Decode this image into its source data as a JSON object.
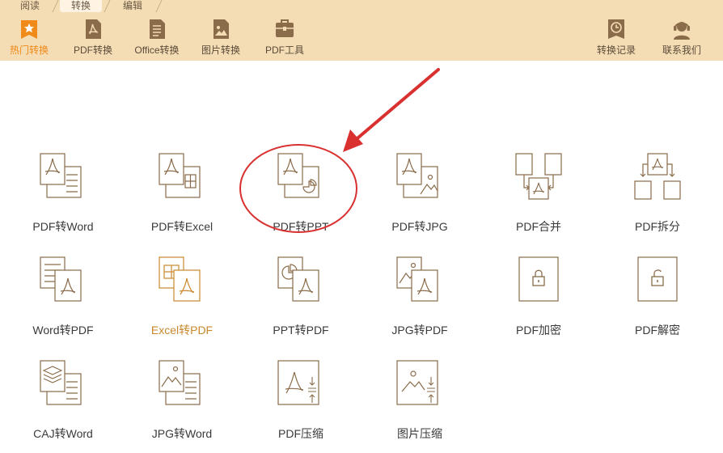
{
  "tabs": [
    {
      "label": "阅读"
    },
    {
      "label": "转换"
    },
    {
      "label": "编辑"
    }
  ],
  "toolbar": {
    "left": [
      {
        "label": "热门转换",
        "icon": "star-icon"
      },
      {
        "label": "PDF转换",
        "icon": "pdf-file-icon"
      },
      {
        "label": "Office转换",
        "icon": "document-icon"
      },
      {
        "label": "图片转换",
        "icon": "image-file-icon"
      },
      {
        "label": "PDF工具",
        "icon": "briefcase-icon"
      }
    ],
    "right": [
      {
        "label": "转换记录",
        "icon": "clock-icon"
      },
      {
        "label": "联系我们",
        "icon": "headset-icon"
      }
    ]
  },
  "grid": [
    {
      "label": "PDF转Word"
    },
    {
      "label": "PDF转Excel"
    },
    {
      "label": "PDF转PPT"
    },
    {
      "label": "PDF转JPG"
    },
    {
      "label": "PDF合并"
    },
    {
      "label": "PDF拆分"
    },
    {
      "label": "Word转PDF"
    },
    {
      "label": "Excel转PDF"
    },
    {
      "label": "PPT转PDF"
    },
    {
      "label": "JPG转PDF"
    },
    {
      "label": "PDF加密"
    },
    {
      "label": "PDF解密"
    },
    {
      "label": "CAJ转Word"
    },
    {
      "label": "JPG转Word"
    },
    {
      "label": "PDF压缩"
    },
    {
      "label": "图片压缩"
    }
  ],
  "colors": {
    "toolbar_bg": "#f4dcb5",
    "accent": "#f08a18",
    "icon_stroke": "#8a6c4a",
    "highlight_text": "#c9882d",
    "annotation_red": "#d93030"
  }
}
